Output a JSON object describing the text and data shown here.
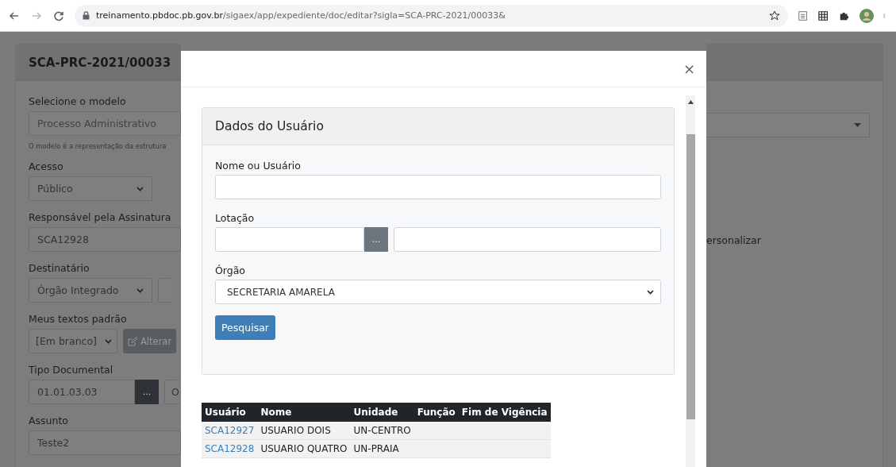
{
  "browser": {
    "url_host": "treinamento.pbdoc.pb.gov.br",
    "url_path": "/sigaex/app/expediente/doc/editar?sigla=SCA-PRC-2021/00033&"
  },
  "form": {
    "title": "SCA-PRC-2021/00033",
    "model_label": "Selecione o modelo",
    "model_value": "Processo Administrativo",
    "model_hint": "O modelo é a representação da estrutura",
    "access_label": "Acesso",
    "access_value": "Público",
    "signer_label": "Responsável pela Assinatura",
    "signer_value": "SCA12928",
    "recipient_label": "Destinatário",
    "recipient_value": "Órgão Integrado",
    "texts_label": "Meus textos padrão",
    "texts_value": "[Em branco]",
    "edit_button": "Alterar",
    "doctype_label": "Tipo Documental",
    "doctype_value": "01.01.03.03",
    "doctype_button": "...",
    "doctype_desc": "O",
    "subject_label": "Assunto",
    "subject_value": "Teste2",
    "right_text": "ersonalizar"
  },
  "modal": {
    "close": "×",
    "card_title": "Dados do Usuário",
    "name_label": "Nome ou Usuário",
    "unit_label": "Lotação",
    "unit_button": "...",
    "org_label": "Órgão",
    "org_value": "SECRETARIA AMARELA",
    "search_button": "Pesquisar",
    "table": {
      "columns": [
        "Usuário",
        "Nome",
        "Unidade",
        "Função",
        "Fim de Vigência"
      ],
      "rows": [
        {
          "user": "SCA12927",
          "name": "USUARIO DOIS",
          "unit": "UN-CENTRO"
        },
        {
          "user": "SCA12928",
          "name": "USUARIO QUATRO",
          "unit": "UN-PRAIA"
        }
      ]
    }
  }
}
